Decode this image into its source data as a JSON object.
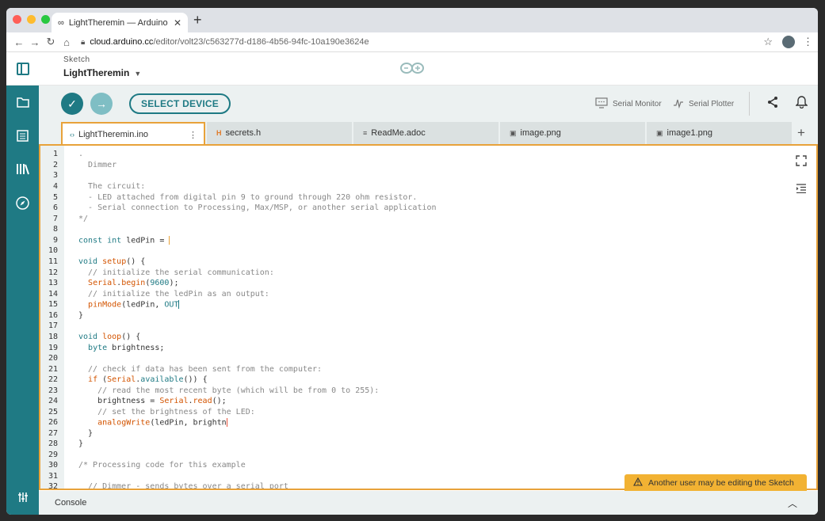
{
  "browser": {
    "tab_title": "LightTheremin — Arduino Edit...",
    "tab_icon": "infinity-icon",
    "url_host": "cloud.arduino.cc",
    "url_path": "/editor/volt23/c563277d-d186-4b56-94fc-10a190e3624e"
  },
  "header": {
    "sketch_label": "Sketch",
    "sketch_name": "LightTheremin"
  },
  "toolbar": {
    "select_device": "SELECT DEVICE",
    "serial_monitor": "Serial Monitor",
    "serial_plotter": "Serial Plotter"
  },
  "tabs": [
    {
      "label": "LightTheremin.ino",
      "icon": "‹›"
    },
    {
      "label": "secrets.h",
      "icon": "H"
    },
    {
      "label": "ReadMe.adoc",
      "icon": "≡"
    },
    {
      "label": "image.png",
      "icon": "▣"
    },
    {
      "label": "image1.png",
      "icon": "▣"
    }
  ],
  "editor": {
    "line_numbers": [
      "1",
      "2",
      "3",
      "4",
      "5",
      "6",
      "7",
      "8",
      "9",
      "10",
      "11",
      "12",
      "13",
      "14",
      "15",
      "16",
      "17",
      "18",
      "19",
      "20",
      "21",
      "22",
      "23",
      "24",
      "25",
      "26",
      "27",
      "28",
      "29",
      "30",
      "31",
      "32"
    ]
  },
  "toast": {
    "message": "Another user may be editing the Sketch"
  },
  "console": {
    "label": "Console"
  },
  "colors": {
    "teal": "#1f7a84",
    "orange": "#e8a23a",
    "warning": "#f2b233"
  }
}
